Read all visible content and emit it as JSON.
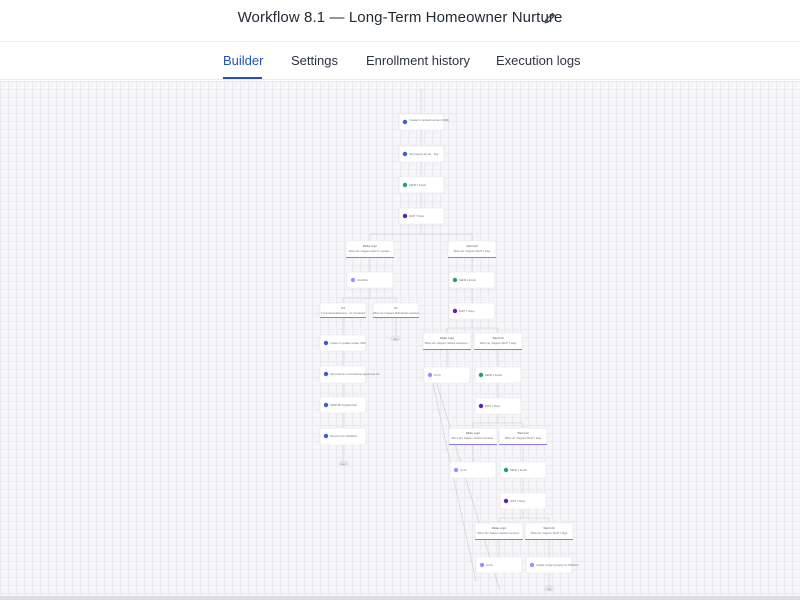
{
  "header": {
    "title": "Workflow 8.1 — Long-Term Homeowner Nurture",
    "edit_icon": "pencil-icon"
  },
  "tabs": [
    {
      "label": "Builder",
      "active": true
    },
    {
      "label": "Settings",
      "active": false
    },
    {
      "label": "Enrollment history",
      "active": false
    },
    {
      "label": "Execution logs",
      "active": false
    }
  ],
  "colors": {
    "accent": "#2451b8",
    "branch_underline": "#8b7cf6",
    "email_icon": "#22a06b",
    "wait_icon": "#5b21b6",
    "action_icon": "#3b5bdb",
    "branch_icon": "#a78bfa"
  },
  "flow": {
    "trigger": "Created or updated contact (CRM)",
    "step1": "Set property for Ho... Pkg",
    "step2": "SEND 1 Email",
    "step3": "WAIT 7 Days",
    "branch_a_title": "If/Else Logic",
    "branch_a_sub": "When do I happen when Il I contact...",
    "branch_b_title": "Wait Until",
    "branch_b_sub": "When do I happen WAIT 7 days",
    "a_condition": "Condition",
    "a_yes": "Yes",
    "a_yes_sub": "If yes/responded/meet... for Contacted",
    "a_no": "No",
    "a_no_sub": "When do I happen ENG Email meetings",
    "a1": "Create or Update contact CRM",
    "a2": "Add property to homeowner opportunity list",
    "a3": "SEND Bin Update Past",
    "a4": "Remove from Workflow",
    "b1": "SEND 1 Email",
    "b2": "WAIT 7 Days",
    "c_left_title": "If/Else Logic",
    "c_left_sub": "When do I happen inactive homeown...",
    "c_right_title": "Wait Until",
    "c_right_sub": "When do I happen WAIT 7 days",
    "c_go": "Go To",
    "c_email": "SEND 1 Email",
    "c_wait": "WAIT 7 Days",
    "d_left_title": "If/Else Logic",
    "d_left_sub": "When do I happen inactive homeow...",
    "d_right_title": "Wait Until",
    "d_right_sub": "When do I happen WAIT 7 days",
    "d_go": "Go To",
    "d_email": "SEND 1 Email",
    "d_wait": "WAIT 7 Days",
    "e_left_title": "If/Else Logic",
    "e_left_sub": "When do I happen inactive homeow...",
    "e_right_title": "Wait Until",
    "e_right_sub": "When do I happen WAIT 7 days",
    "e_go": "Go To",
    "e_last": "Update contact property for Winback..."
  },
  "end_label": "END"
}
